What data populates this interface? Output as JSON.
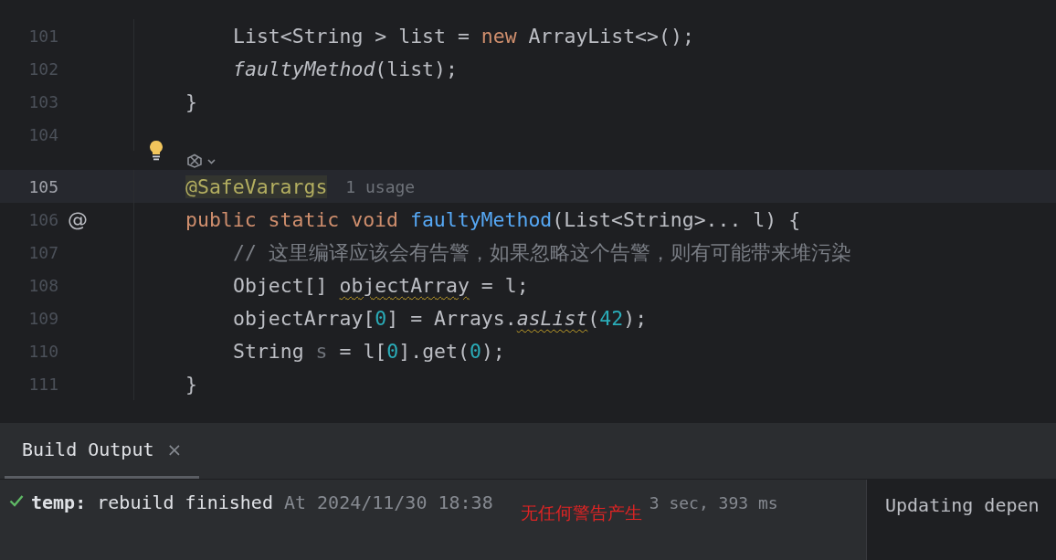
{
  "editor": {
    "lines": [
      {
        "children": [
          {
            "number": "101",
            "current": false,
            "tokens": [
              {
                "text": "List<String > list = ",
                "kind": "plain"
              },
              {
                "text": "new",
                "kind": "keyword"
              },
              {
                "text": " ArrayList<>();",
                "kind": "plain"
              }
            ]
          },
          {
            "number": "102",
            "current": false,
            "tokens": [
              {
                "text": "faultyMethod",
                "kind": "static_call"
              },
              {
                "text": "(list);",
                "kind": "plain"
              }
            ]
          }
        ]
      },
      {
        "number": "103",
        "current": false,
        "tokens": [
          {
            "text": "}",
            "kind": "plain"
          }
        ]
      },
      {
        "number": "104",
        "current": false,
        "gutter_bulb": true,
        "ai_marker": true
      },
      {
        "number": "105",
        "current": true,
        "tokens": [
          {
            "text": "@SafeVarargs",
            "kind": "annotation"
          }
        ],
        "hint": "1 usage"
      },
      {
        "number": "106",
        "current": false,
        "gutter_at": "@",
        "tokens": [
          {
            "text": "public static void ",
            "kind": "keyword"
          },
          {
            "text": "faultyMethod",
            "kind": "method"
          },
          {
            "text": "(List<String>... l) {",
            "kind": "plain"
          }
        ],
        "children": [
          {
            "number": "107",
            "current": false,
            "tokens": [
              {
                "text": "// 这里编译应该会有告警，如果忽略这个告警，则有可能带来堆污染",
                "kind": "comment"
              }
            ]
          },
          {
            "number": "108",
            "current": false,
            "tokens": [
              {
                "text": "Object[] ",
                "kind": "plain"
              },
              {
                "text": "objectArray",
                "kind": "plain",
                "warning": true
              },
              {
                "text": " = l;",
                "kind": "plain"
              }
            ]
          },
          {
            "number": "109",
            "current": false,
            "tokens": [
              {
                "text": "objectArray[",
                "kind": "plain"
              },
              {
                "text": "0",
                "kind": "number"
              },
              {
                "text": "] = Arrays.",
                "kind": "plain"
              },
              {
                "text": "asList",
                "kind": "static_call",
                "warning": true
              },
              {
                "text": "(",
                "kind": "plain"
              },
              {
                "text": "42",
                "kind": "number"
              },
              {
                "text": ");",
                "kind": "plain"
              }
            ]
          },
          {
            "number": "110",
            "current": false,
            "tokens": [
              {
                "text": "String ",
                "kind": "plain"
              },
              {
                "text": "s",
                "kind": "unused"
              },
              {
                "text": " = l[",
                "kind": "plain"
              },
              {
                "text": "0",
                "kind": "number"
              },
              {
                "text": "].get(",
                "kind": "plain"
              },
              {
                "text": "0",
                "kind": "number"
              },
              {
                "text": ");",
                "kind": "plain"
              }
            ]
          }
        ]
      },
      {
        "number": "111",
        "current": false,
        "tokens": [
          {
            "text": "}",
            "kind": "plain"
          }
        ]
      }
    ]
  },
  "build_panel": {
    "tabs": [
      {
        "label": "Build Output",
        "selected": true,
        "close": "×"
      }
    ],
    "result": {
      "success": true,
      "project": "temp:",
      "message": "rebuild finished",
      "time": "At 2024/11/30 18:38",
      "note": "无任何警告产生",
      "duration": "3 sec, 393 ms"
    },
    "console_lines": [
      "Updating depen"
    ]
  }
}
